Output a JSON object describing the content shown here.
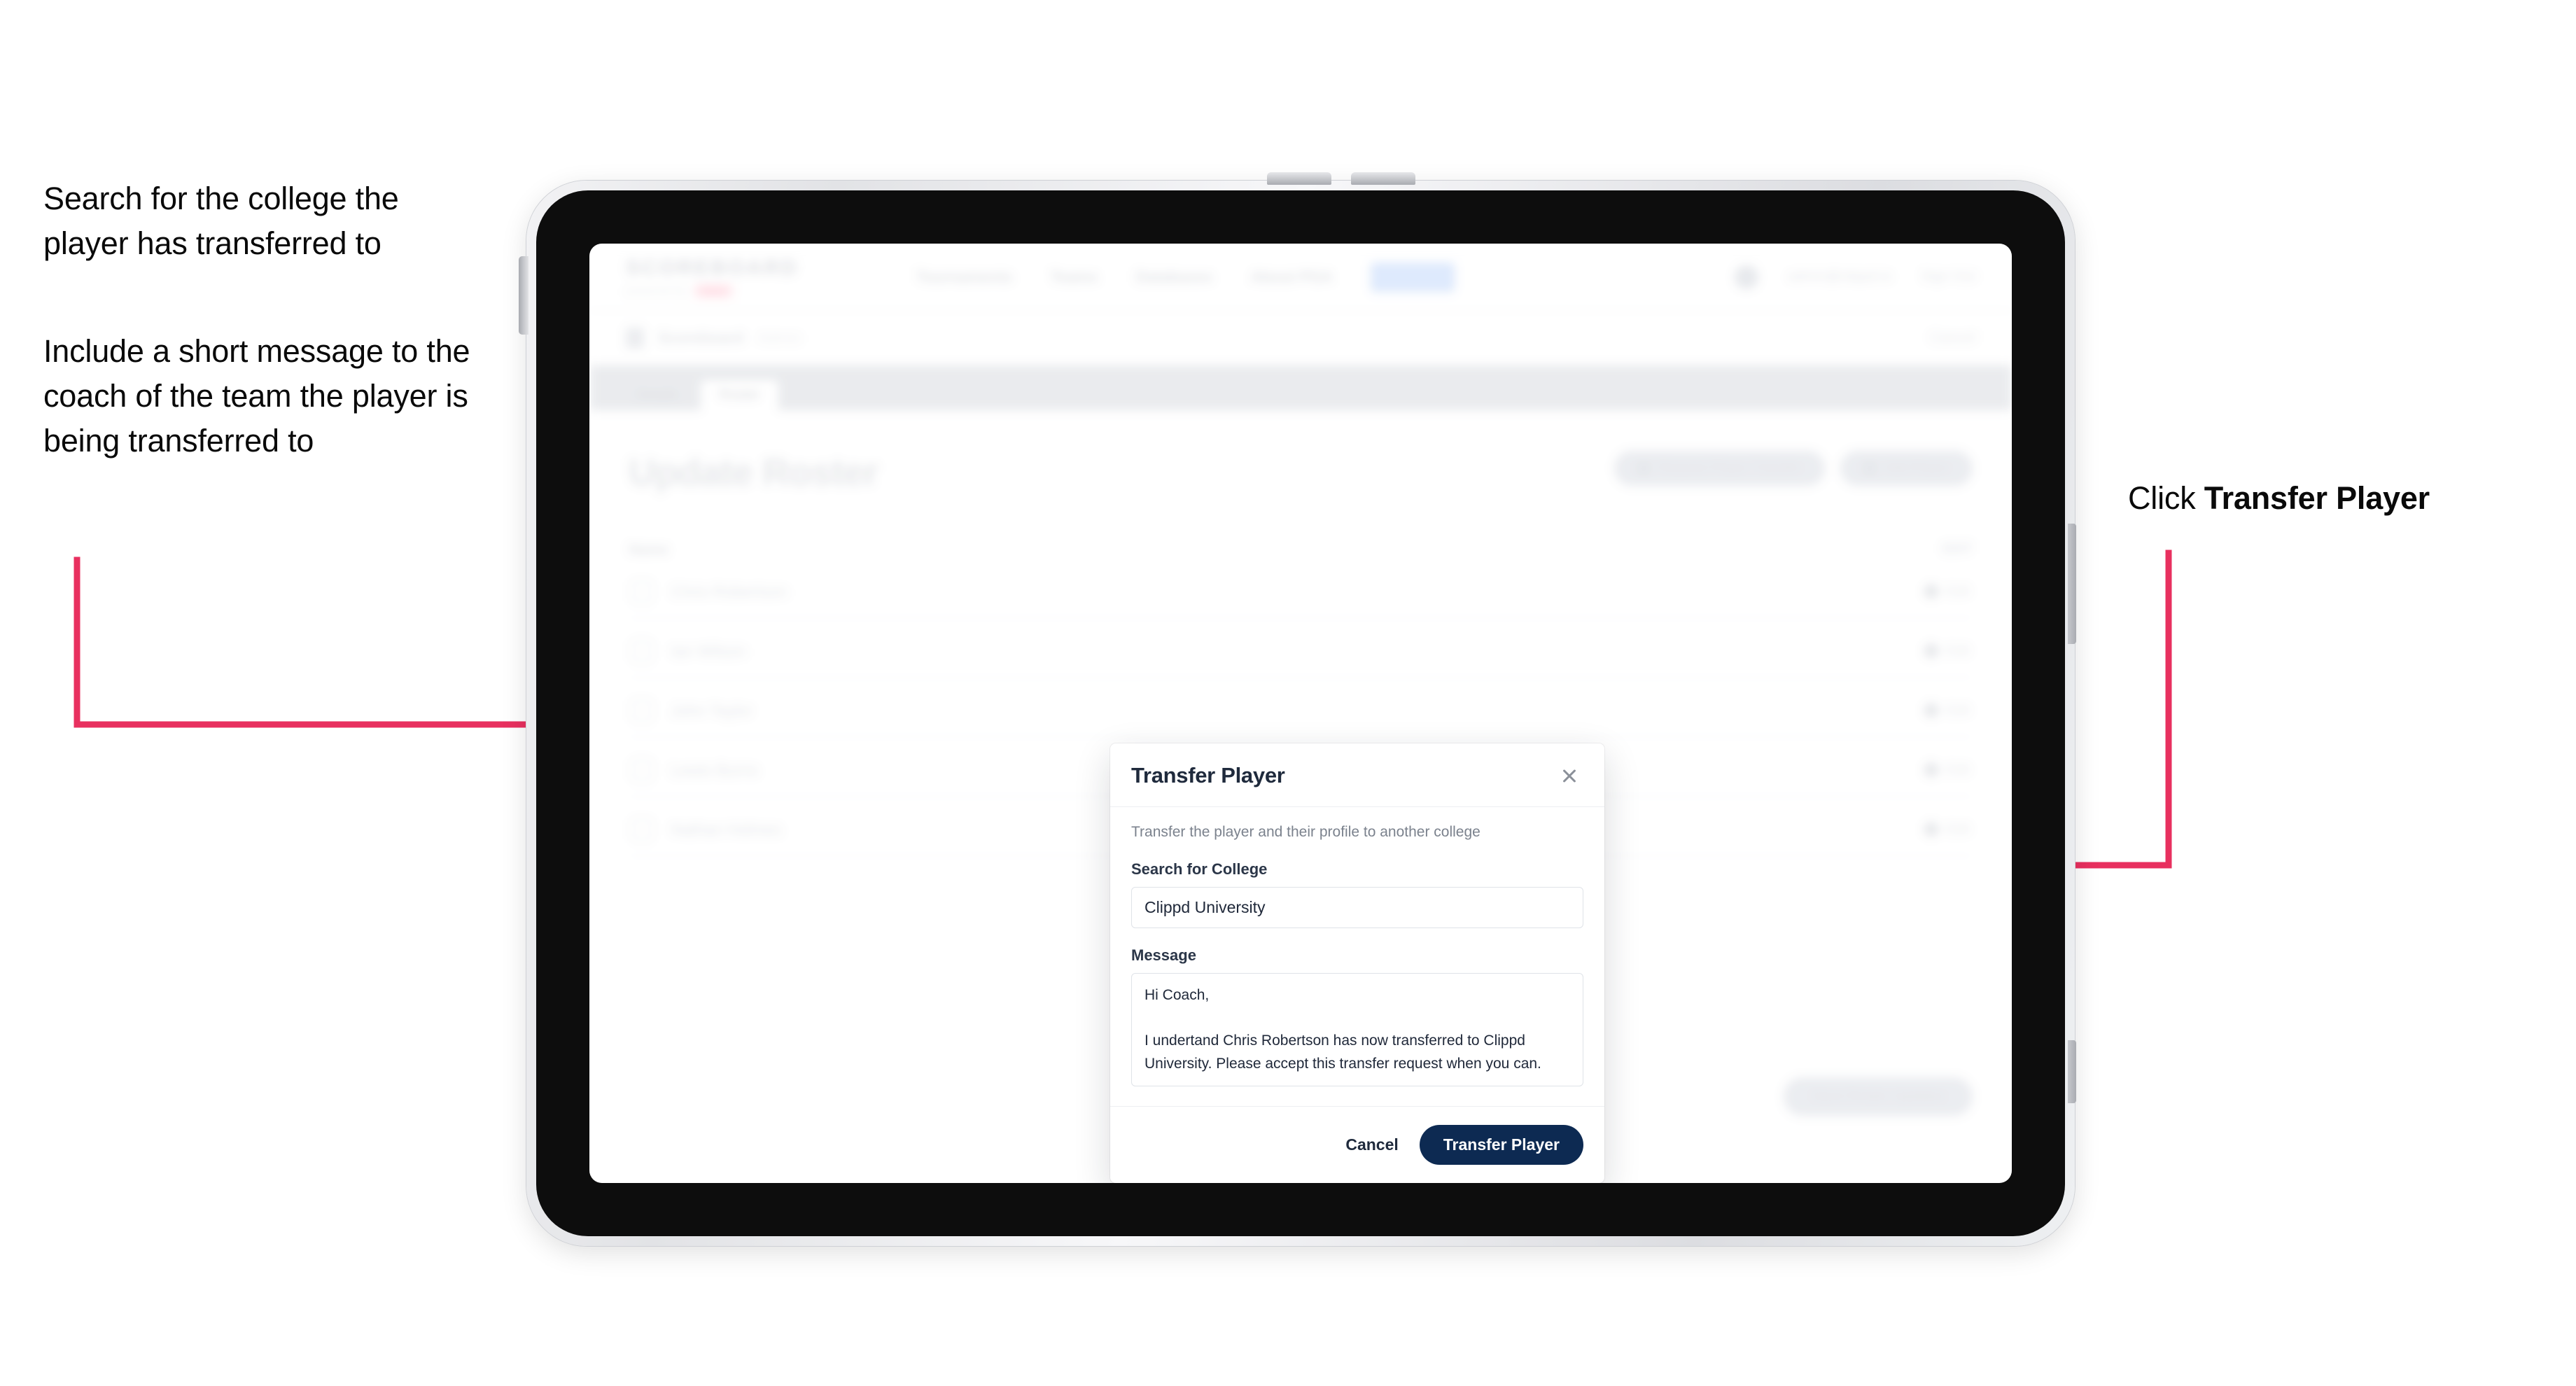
{
  "annotations": {
    "left_1": "Search for the college the player has transferred to",
    "left_2": "Include a short message to the coach of the team the player is being transferred to",
    "right_prefix": "Click ",
    "right_bold": "Transfer Player",
    "arrow_color": "#E8305F"
  },
  "app": {
    "logo": {
      "main": "SCOREBOARD",
      "sub": "powered by",
      "badge": "clippd"
    },
    "nav": [
      {
        "label": "Tournaments"
      },
      {
        "label": "Teams"
      },
      {
        "label": "Databases"
      },
      {
        "label": "About PGA"
      },
      {
        "label": "Admin",
        "active": true
      }
    ],
    "header_right": {
      "email": "admin@clippd.io",
      "sign_out": "Sign Out",
      "avatar": "avatar"
    },
    "breadcrumb": {
      "icon": "shield-icon",
      "title": "Scoreboard",
      "sub": "Admin",
      "cancel": "Cancel"
    },
    "tabs": [
      {
        "label": "Details",
        "active": false
      },
      {
        "label": "Roster",
        "active": true
      }
    ],
    "page_title": "Update Roster",
    "actions": [
      {
        "label": "Request Player Transfer",
        "icon": "swap-icon"
      },
      {
        "label": "Add Player",
        "icon": "plus-icon"
      }
    ],
    "roster": {
      "col_name": "Name",
      "col_edit": "EDIT",
      "rows": [
        {
          "name": "Chris Robertson",
          "edit": "Edit"
        },
        {
          "name": "Ian Wilson",
          "edit": "Edit"
        },
        {
          "name": "John Taylor",
          "edit": "Edit"
        },
        {
          "name": "Lewis Burns",
          "edit": "Edit"
        },
        {
          "name": "Nathan Holmes",
          "edit": "Edit"
        }
      ]
    },
    "save_button": "Save Roster Updates"
  },
  "modal": {
    "title": "Transfer Player",
    "close_icon": "close-icon",
    "subtitle": "Transfer the player and their profile to another college",
    "college_label": "Search for College",
    "college_value": "Clippd University",
    "college_placeholder": "Search for College",
    "message_label": "Message",
    "message_value": "Hi Coach,\n\nI undertand Chris Robertson has now transferred to Clippd University. Please accept this transfer request when you can.",
    "message_placeholder": "Message",
    "cancel_label": "Cancel",
    "submit_label": "Transfer Player",
    "submit_color": "#0D2A52"
  }
}
